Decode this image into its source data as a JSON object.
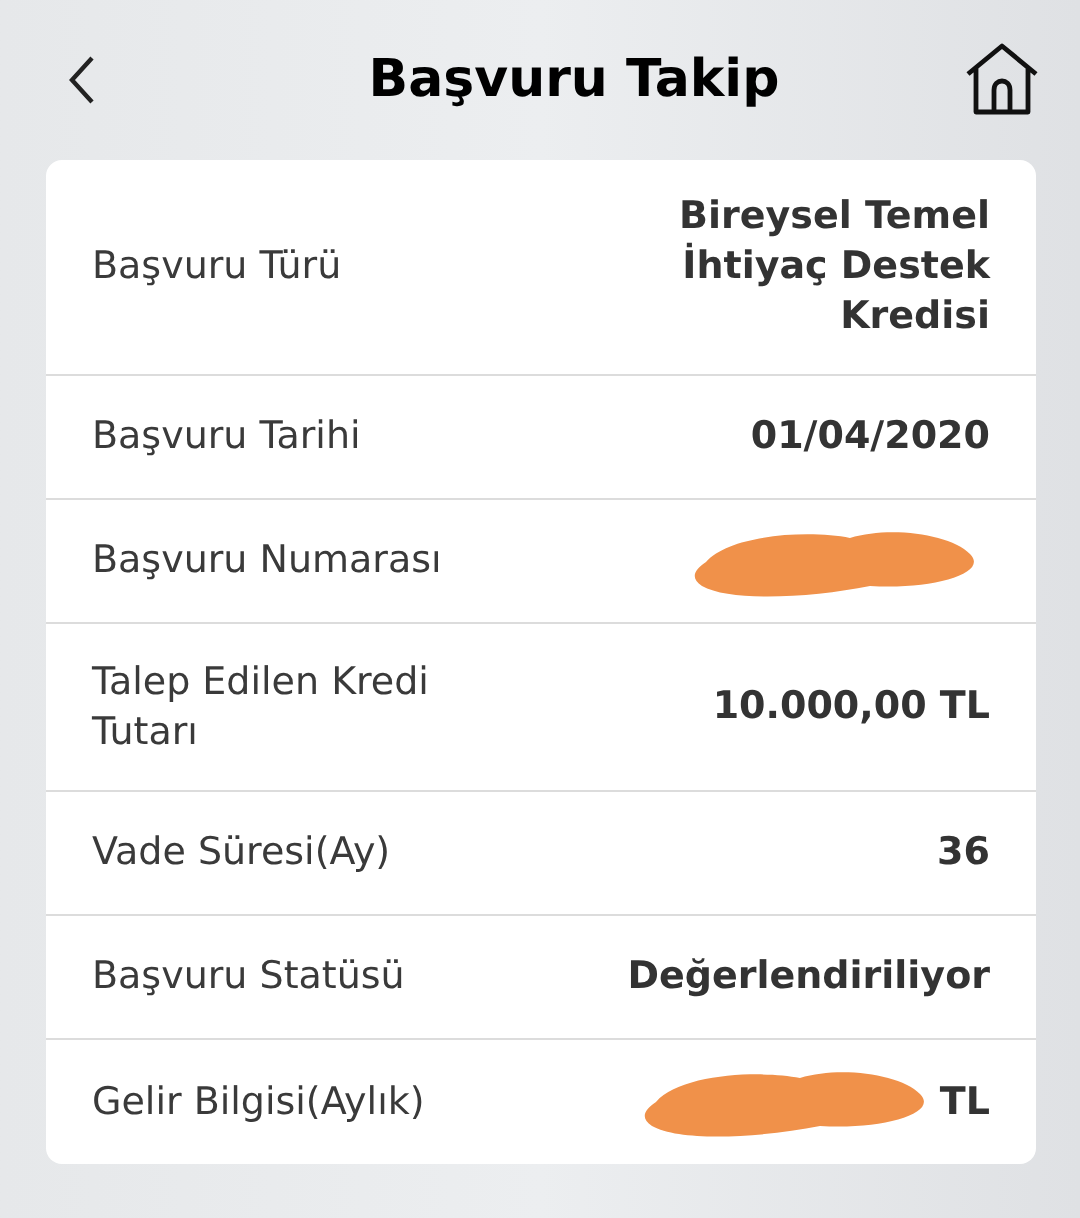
{
  "header": {
    "title": "Başvuru Takip"
  },
  "rows": [
    {
      "label": "Başvuru Türü",
      "value": "Bireysel Temel İhtiyaç Destek Kredisi",
      "redacted": false
    },
    {
      "label": "Başvuru Tarihi",
      "value": "01/04/2020",
      "redacted": false
    },
    {
      "label": "Başvuru Numarası",
      "redacted": true
    },
    {
      "label": "Talep Edilen Kredi Tutarı",
      "value": "10.000,00 TL",
      "redacted": false
    },
    {
      "label": "Vade Süresi(Ay)",
      "value": "36",
      "redacted": false
    },
    {
      "label": "Başvuru Statüsü",
      "value": "Değerlendiriliyor",
      "redacted": false
    },
    {
      "label": "Gelir Bilgisi(Aylık)",
      "value": "TL",
      "redacted": true
    }
  ]
}
